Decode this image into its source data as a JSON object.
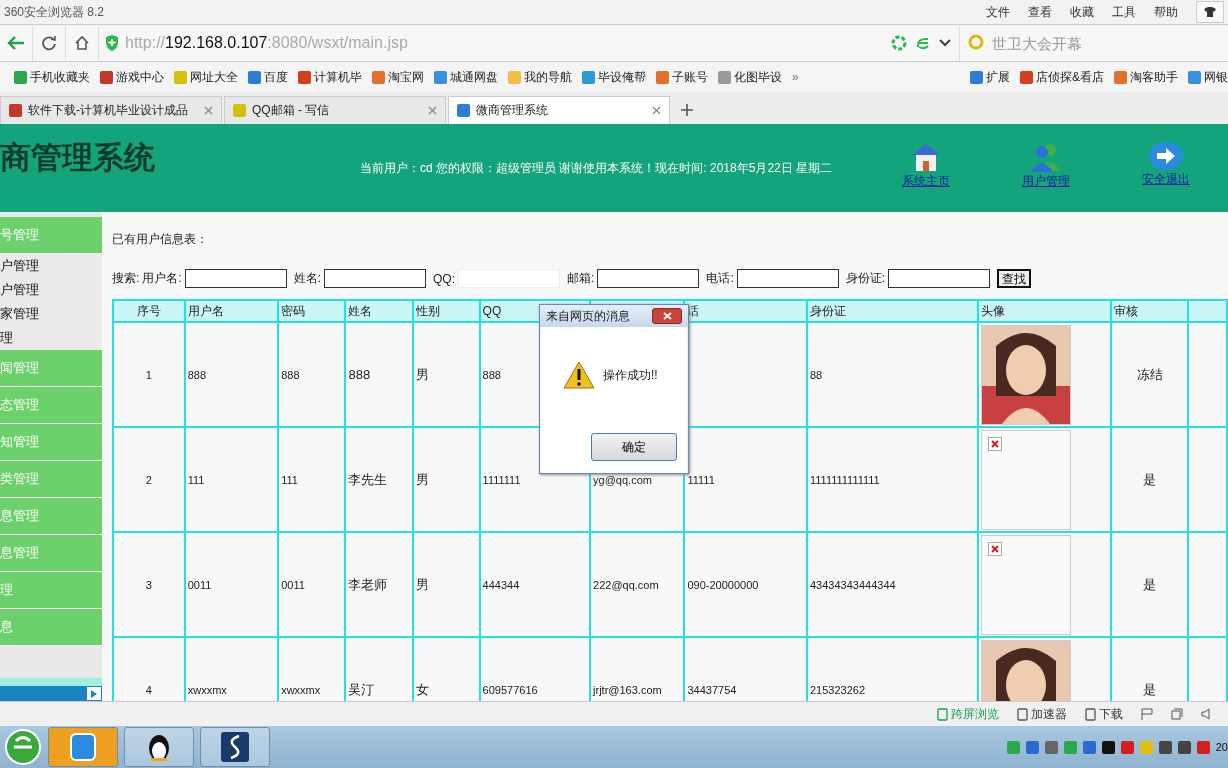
{
  "browser": {
    "title": "360安全浏览器 8.2",
    "menu": [
      "文件",
      "查看",
      "收藏",
      "工具",
      "帮助"
    ],
    "url": {
      "scheme": "http://",
      "host": "192.168.0.107",
      "path": ":8080/wsxt/main.jsp"
    },
    "search": {
      "placeholder": "世卫大会开幕"
    },
    "bookmarks": [
      "手机收藏夹",
      "游戏中心",
      "网址大全",
      "百度",
      "计算机毕",
      "淘宝网",
      "城通网盘",
      "我的导航",
      "毕设俺帮",
      "子账号",
      "化图毕设"
    ],
    "more": "»",
    "extensions": [
      "扩展",
      "店侦探&看店",
      "淘客助手",
      "网银"
    ],
    "tabs": [
      {
        "label": "软件下载-计算机毕业设计成品",
        "selected": false
      },
      {
        "label": "QQ邮箱 - 写信",
        "selected": false
      },
      {
        "label": "微商管理系统",
        "selected": true
      }
    ]
  },
  "header": {
    "title": "商管理系统",
    "info": "当前用户：cd 您的权限：超级管理员 谢谢使用本系统！现在时间: 2018年5月22日 星期二",
    "links": [
      {
        "label": "系统主页",
        "kind": "home"
      },
      {
        "label": "用户管理",
        "kind": "users"
      },
      {
        "label": "安全退出",
        "kind": "exit"
      }
    ]
  },
  "sidebar": {
    "items": [
      {
        "label": "号管理",
        "kind": "group"
      },
      {
        "label": "户管理",
        "kind": "sub"
      },
      {
        "label": "户管理",
        "kind": "sub"
      },
      {
        "label": "家管理",
        "kind": "sub"
      },
      {
        "label": "理",
        "kind": "sub"
      },
      {
        "label": "闻管理",
        "kind": "group"
      },
      {
        "label": "态管理",
        "kind": "group"
      },
      {
        "label": "知管理",
        "kind": "group"
      },
      {
        "label": "类管理",
        "kind": "group"
      },
      {
        "label": "息管理",
        "kind": "group"
      },
      {
        "label": "息管理",
        "kind": "group"
      },
      {
        "label": "理",
        "kind": "group"
      },
      {
        "label": "息",
        "kind": "group"
      }
    ]
  },
  "content": {
    "heading": "已有用户信息表：",
    "search": {
      "prefix": "搜索:",
      "fields": [
        "用户名:",
        "姓名:",
        "QQ:",
        "邮箱:",
        "电话:",
        "身份证:"
      ],
      "button": "查找"
    },
    "table": {
      "columns": [
        "序号",
        "用户名",
        "密码",
        "姓名",
        "性别",
        "QQ",
        "",
        "话",
        "身份证",
        "头像",
        "审核",
        ""
      ],
      "rows": [
        {
          "cells": [
            "1",
            "888",
            "888",
            "888",
            "男",
            "888",
            "",
            "",
            "88"
          ],
          "status": "冻结"
        },
        {
          "cells": [
            "2",
            "111",
            "111",
            "李先生",
            "男",
            "1111111",
            "yg@qq.com",
            "11111",
            "1111111111111"
          ],
          "avatar": {
            "kind": "broken"
          },
          "status": "是"
        },
        {
          "cells": [
            "3",
            "0011",
            "0011",
            "李老师",
            "男",
            "444344",
            "222@qq.com",
            "090-20000000",
            "43434343444344"
          ],
          "avatar": {
            "kind": "broken"
          },
          "status": "是"
        },
        {
          "cells": [
            "4",
            "xwxxmx",
            "xwxxmx",
            "吴汀",
            "女",
            "609577616",
            "jrjtr@163.com",
            "34437754",
            "215323262"
          ],
          "status": "是"
        }
      ]
    }
  },
  "dialog": {
    "title": "来自网页的消息",
    "message": "操作成功!!",
    "button": "确定"
  },
  "status_bar": {
    "items": [
      "跨屏浏览",
      "加速器",
      "下载"
    ]
  },
  "taskbar": {
    "clock": "20"
  }
}
